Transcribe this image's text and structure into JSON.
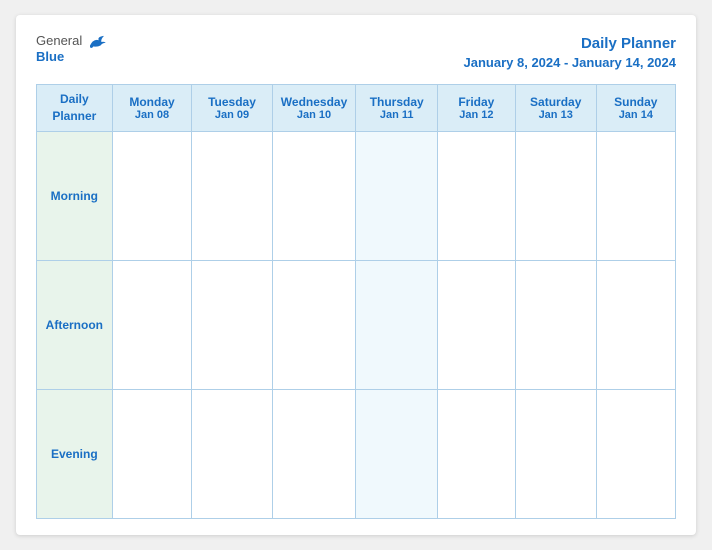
{
  "logo": {
    "general": "General",
    "blue": "Blue"
  },
  "header": {
    "title": "Daily Planner",
    "date_range": "January 8, 2024 - January 14, 2024"
  },
  "table": {
    "col_header": "Daily\nPlanner",
    "days": [
      {
        "name": "Monday",
        "date": "Jan 08"
      },
      {
        "name": "Tuesday",
        "date": "Jan 09"
      },
      {
        "name": "Wednesday",
        "date": "Jan 10"
      },
      {
        "name": "Thursday",
        "date": "Jan 11"
      },
      {
        "name": "Friday",
        "date": "Jan 12"
      },
      {
        "name": "Saturday",
        "date": "Jan 13"
      },
      {
        "name": "Sunday",
        "date": "Jan 14"
      }
    ],
    "rows": [
      {
        "label": "Morning"
      },
      {
        "label": "Afternoon"
      },
      {
        "label": "Evening"
      }
    ]
  }
}
